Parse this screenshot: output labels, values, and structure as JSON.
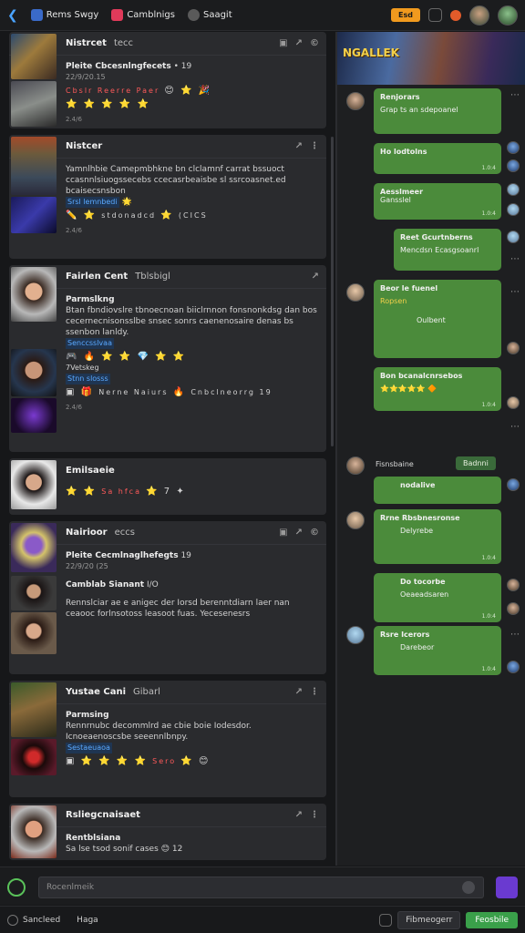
{
  "topbar": {
    "tabs": [
      {
        "label": "Rems Swgy",
        "icon": "home-icon"
      },
      {
        "label": "Camblnigs",
        "icon": "game-icon"
      },
      {
        "label": "Saagit",
        "icon": "discord-icon"
      }
    ],
    "orange_button": "Esd"
  },
  "feed": {
    "cards": [
      {
        "title": "Nistrcet",
        "subtitle": "tecc",
        "line1": "Pleite Cbcesnlngfecets",
        "line1_tail": "• 19",
        "line2": "22/9/20.15",
        "line3": "Cbslr Reerre Paer",
        "meta": "2.4/6"
      },
      {
        "title": "Nistcer",
        "body": "Yamnlhbie Camepmbhkne bn clclamnf carrat bssuoct ccasnnlsiuogssecebs ccecasrbeaisbe sl ssrcoasnet.ed bcaisecsnsbon",
        "tag": "Srsl lemnbedi",
        "emoji_line": "stdonadcd",
        "emoji_tail": "(CICS",
        "meta": "2.4/6"
      },
      {
        "title": "Fairlen Cent",
        "subtitle": "Tblsbigl",
        "heading": "Parmslkng",
        "body": "Btan fbndiovslre tbnoecnoan biiclrnnon fonsnonkdsg dan bos cecernecnisonsslbe snsec sonrs caenenosaire denas bs ssenbon lanldy.",
        "link1": "Senccsslvaa",
        "link2": "7Vetskeg",
        "tag": "Stnn slosss",
        "line": "Nerne Naiurs",
        "line_tail": "Cnbclneorrg 19",
        "meta": "2.4/6"
      },
      {
        "title": "Emilsaeie",
        "line": "Sa hfca",
        "meta": ""
      },
      {
        "title": "Nairioor",
        "subtitle": "eccs",
        "line1": "Pleite Cecmlnaglhefegts",
        "line1_tail": "19",
        "line2": "22/9/20 (25",
        "heading": "Camblab Sianant",
        "heading_tail": "I/O",
        "body": "Rennslciar ae e anigec der Iorsd berenntdiarn laer nan ceaooc forlnsotoss leasoot fuas. Yecesenesrs",
        "meta": ""
      },
      {
        "title": "Yustae Cani",
        "subtitle": "Gibarl",
        "heading": "Parmsing",
        "body": "Rennrnubc decommlrd ae cbie boie Iodesdor. Icnoeaenoscsbe seeennlbnpy.",
        "tag": "Sestaeuaoa",
        "line_tail": "Sero",
        "meta": ""
      },
      {
        "title": "Rsliegcnaisaet",
        "heading": "Rentblsiana",
        "line": "Sa lse tsod sonif cases",
        "line_tail": "12",
        "meta": ""
      }
    ]
  },
  "chat": {
    "banner_title": "NGALLEK",
    "messages": [
      {
        "title": "Renjorars",
        "line": "Grap ts an sdepoanel",
        "ts": ""
      },
      {
        "title": "Ho lodtolns",
        "line": "",
        "ts": "1.0:4"
      },
      {
        "title": "Aesslmeer",
        "line": "Gansslel",
        "ts": "1.0:4"
      },
      {
        "title": "Reet Gcurtnberns",
        "line": "Mencdsn Ecasgsoanrl",
        "ts": ""
      },
      {
        "title": "Beor le fuenel",
        "line": "Ropsen",
        "line2": "Oulbent",
        "ts": ""
      },
      {
        "title": "Bon bcanalcnrsebos",
        "line": "",
        "ts": "1.0:4"
      },
      {
        "title": "nodalive",
        "line": "",
        "ts": ""
      },
      {
        "title": "Rrne Rbsbnesronse",
        "line": "Delyrebe",
        "ts": "1.0:4"
      },
      {
        "title": "Do tocorbe",
        "line": "Oeaeadsaren",
        "ts": "1.0:4"
      },
      {
        "title": "Rsre Icerors",
        "line": "Darebeor",
        "ts": "1.0:4"
      }
    ],
    "name_label": "Fisnsbaine",
    "pill_label": "Badnni"
  },
  "composer": {
    "placeholder": "Rocenlmeik"
  },
  "bottombar": {
    "items": [
      "Sancleed",
      "Haga"
    ],
    "btn_dark": "Fibmeogerr",
    "btn_green": "Feosbile"
  }
}
